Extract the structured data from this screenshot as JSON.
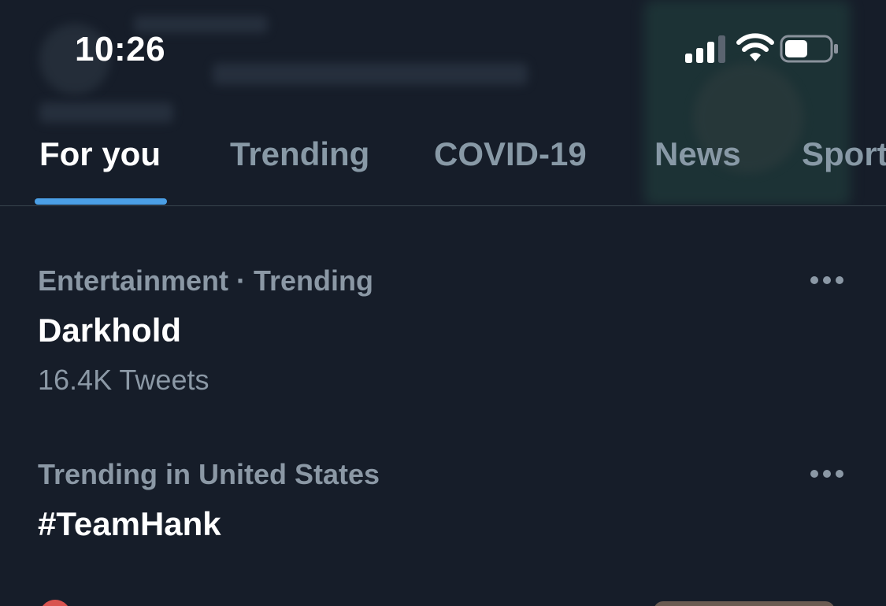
{
  "status_bar": {
    "time": "10:26"
  },
  "tabs": [
    {
      "label": "For you",
      "active": true
    },
    {
      "label": "Trending",
      "active": false
    },
    {
      "label": "COVID-19",
      "active": false
    },
    {
      "label": "News",
      "active": false
    },
    {
      "label": "Sport",
      "active": false
    }
  ],
  "trends": [
    {
      "context": "Entertainment · Trending",
      "title": "Darkhold",
      "count": "16.4K Tweets"
    },
    {
      "context": "Trending in United States",
      "title": "#TeamHank"
    }
  ],
  "icons": {
    "signal": "cellular-signal-icon",
    "wifi": "wifi-icon",
    "battery": "battery-icon",
    "more": "more-horizontal-icon"
  },
  "colors": {
    "background": "#161d29",
    "accent": "#4b9fe6",
    "text_primary": "#ffffff",
    "text_secondary": "#8b98a5"
  }
}
